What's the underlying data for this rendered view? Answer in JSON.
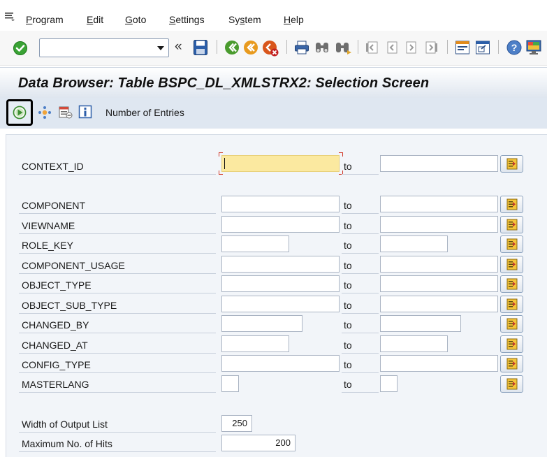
{
  "menu": {
    "items": [
      {
        "prefix": "",
        "underline": "P",
        "rest": "rogram"
      },
      {
        "prefix": "",
        "underline": "E",
        "rest": "dit"
      },
      {
        "prefix": "",
        "underline": "G",
        "rest": "oto"
      },
      {
        "prefix": "",
        "underline": "S",
        "rest": "ettings"
      },
      {
        "prefix": "Sy",
        "underline": "s",
        "rest": "tem"
      },
      {
        "prefix": "",
        "underline": "H",
        "rest": "elp"
      }
    ]
  },
  "toolbar": {
    "command_field_value": "",
    "icons": [
      "enter-icon",
      "save-icon",
      "back-icon",
      "exit-icon",
      "cancel-icon",
      "print-icon",
      "find-icon",
      "find-next-icon",
      "first-page-icon",
      "previous-page-icon",
      "next-page-icon",
      "last-page-icon",
      "create-session-icon",
      "shortcut-icon",
      "help-icon",
      "layout-icon"
    ]
  },
  "title": "Data Browser: Table BSPC_DL_XMLSTRX2: Selection Screen",
  "app_toolbar": {
    "number_of_entries_label": "Number of Entries"
  },
  "selection": {
    "to_label": "to",
    "fields": [
      {
        "name": "CONTEXT_ID",
        "low": "",
        "high": ""
      },
      {
        "name": "COMPONENT",
        "low": "",
        "high": ""
      },
      {
        "name": "VIEWNAME",
        "low": "",
        "high": ""
      },
      {
        "name": "ROLE_KEY",
        "low": "",
        "high": ""
      },
      {
        "name": "COMPONENT_USAGE",
        "low": "",
        "high": ""
      },
      {
        "name": "OBJECT_TYPE",
        "low": "",
        "high": ""
      },
      {
        "name": "OBJECT_SUB_TYPE",
        "low": "",
        "high": ""
      },
      {
        "name": "CHANGED_BY",
        "low": "",
        "high": ""
      },
      {
        "name": "CHANGED_AT",
        "low": "",
        "high": ""
      },
      {
        "name": "CONFIG_TYPE",
        "low": "",
        "high": ""
      },
      {
        "name": "MASTERLANG",
        "low": "",
        "high": ""
      }
    ],
    "width_of_output_list": {
      "label": "Width of Output List",
      "value": "250"
    },
    "maximum_no_of_hits": {
      "label": "Maximum No. of Hits",
      "value": "200"
    }
  },
  "colors": {
    "focused_field": "#fbe9a0",
    "title_gradient_end": "#dfe6ef",
    "app_toolbar": "#dfe7f1",
    "selection_background": "#f2f5f9"
  }
}
